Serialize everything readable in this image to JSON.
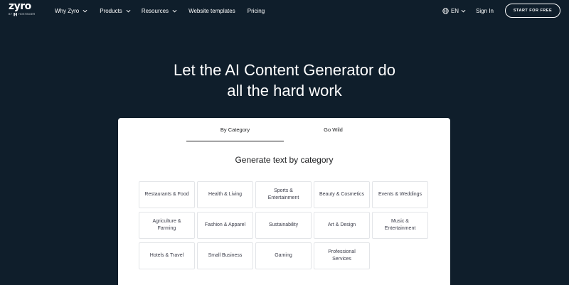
{
  "nav": {
    "logo_word": "zyro",
    "logo_sub_by": "BY",
    "logo_sub_brand": "HOSTINGER",
    "links": [
      {
        "label": "Why Zyro",
        "dropdown": true
      },
      {
        "label": "Products",
        "dropdown": true
      },
      {
        "label": "Resources",
        "dropdown": true
      },
      {
        "label": "Website templates",
        "dropdown": false
      },
      {
        "label": "Pricing",
        "dropdown": false
      }
    ],
    "language": "EN",
    "signin": "Sign In",
    "cta": "START FOR FREE"
  },
  "hero": {
    "line1": "Let the AI Content Generator do",
    "line2": "all the hard work"
  },
  "card": {
    "tabs": [
      {
        "label": "By Category",
        "active": true
      },
      {
        "label": "Go Wild",
        "active": false
      }
    ],
    "subtitle": "Generate text by category",
    "categories": [
      [
        "Restaurants & Food"
      ],
      [
        "Health & Living"
      ],
      [
        "Sports &",
        "Entertainment"
      ],
      [
        "Beauty & Cosmetics"
      ],
      [
        "Events & Weddings"
      ],
      [
        "Agriculture &",
        "Farming"
      ],
      [
        "Fashion & Apparel"
      ],
      [
        "Sustainability"
      ],
      [
        "Art & Design"
      ],
      [
        "Music &",
        "Entertainment"
      ],
      [
        "Hotels & Travel"
      ],
      [
        "Small Business"
      ],
      [
        "Gaming"
      ],
      [
        "Professional",
        "Services"
      ]
    ]
  },
  "colors": {
    "background": "#0f1e2b",
    "card": "#ffffff",
    "text_dark": "#1d1e20",
    "chip_border": "#e3e5e8"
  },
  "icons": {
    "globe": "globe-icon",
    "chevron": "chevron-down-icon"
  }
}
